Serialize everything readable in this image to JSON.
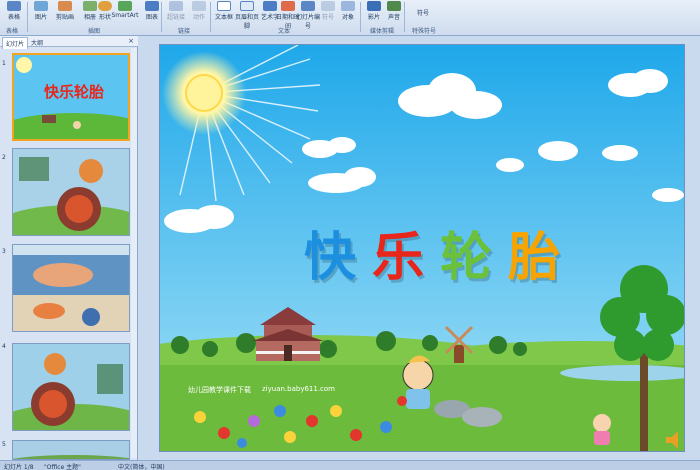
{
  "ribbon": {
    "groups": {
      "tables": "表格",
      "illustrations": "插图",
      "links": "链接",
      "text": "文本",
      "media": "媒体剪辑",
      "symbols": "特殊符号"
    },
    "buttons": {
      "table": "表格",
      "picture": "图片",
      "clipart": "剪贴画",
      "album": "相册",
      "shapes": "形状",
      "smartart": "SmartArt",
      "chart": "图表",
      "hyperlink": "超链接",
      "action": "动作",
      "textbox": "文本框",
      "headerfooter": "页眉和页脚",
      "wordart": "艺术字",
      "datetime": "日期和时间",
      "slidenumber": "幻灯片编号",
      "symbol": "符号",
      "object": "对象",
      "movie": "影片",
      "sound": "声音",
      "specialsymbol": "符号"
    }
  },
  "panel": {
    "tabs": [
      "幻灯片",
      "大纲"
    ],
    "close": "×",
    "slide_numbers": [
      "1",
      "2",
      "3",
      "4",
      "5"
    ]
  },
  "slide": {
    "title_chars": [
      "快",
      "乐",
      "轮",
      "胎"
    ],
    "title_colors": [
      "#1d8fe0",
      "#e8261c",
      "#6cc13a",
      "#f7a400"
    ],
    "footer_text": "幼儿园教学课件下载",
    "footer_url": "ziyuan.baby611.com",
    "thumb_title": "快乐轮胎"
  },
  "status": {
    "slide_info": "幻灯片 1/8",
    "theme": "\"Office 主题\"",
    "language": "中文(简体，中国)"
  }
}
